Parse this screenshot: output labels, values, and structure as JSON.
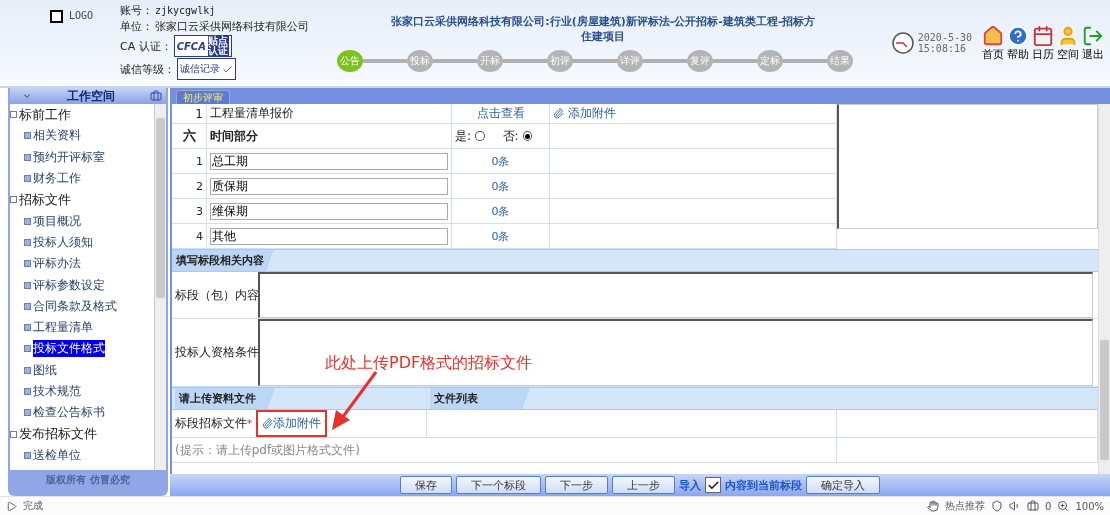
{
  "header": {
    "logo": "LOGO",
    "account_label": "账号：",
    "account": "zjkycgwlkj",
    "unit_label": "单位：",
    "unit": "张家口云采供网络科技有限公司",
    "ca_label": "CA 认证：",
    "ca_badge": "CFCA",
    "ca_badge_note": "贴点认证",
    "credit_label": "诚信等级：",
    "credit_badge": "诚信记录"
  },
  "title": {
    "line1": "张家口云采供网络科技有限公司:行业(房屋建筑)新评标法-公开招标-建筑类工程-招标方",
    "line2": "住建项目"
  },
  "steps": [
    {
      "label": "公告",
      "selected": true
    },
    {
      "label": "投标",
      "selected": false
    },
    {
      "label": "开标",
      "selected": false
    },
    {
      "label": "初评",
      "selected": false
    },
    {
      "label": "详评",
      "selected": false
    },
    {
      "label": "复评",
      "selected": false
    },
    {
      "label": "定标",
      "selected": false
    },
    {
      "label": "结果",
      "selected": false
    }
  ],
  "clock": {
    "date": "2020-5-30",
    "time": "15:08:16"
  },
  "nav": [
    {
      "kind": "home",
      "label": "首页"
    },
    {
      "kind": "help",
      "label": "帮助"
    },
    {
      "kind": "calendar",
      "label": "日历"
    },
    {
      "kind": "space",
      "label": "空间"
    },
    {
      "kind": "exit",
      "label": "退出"
    }
  ],
  "sidebar": {
    "title": "工作空间",
    "footer": "版权所有 仿冒必究",
    "tree": [
      {
        "label": "标前工作",
        "expanded": true,
        "children": [
          {
            "label": "相关资料",
            "selected": false
          },
          {
            "label": "预约开评标室",
            "selected": false
          },
          {
            "label": "财务工作",
            "selected": false
          }
        ]
      },
      {
        "label": "招标文件",
        "expanded": true,
        "children": [
          {
            "label": "项目概况",
            "selected": false
          },
          {
            "label": "投标人须知",
            "selected": false
          },
          {
            "label": "评标办法",
            "selected": false
          },
          {
            "label": "评标参数设定",
            "selected": false
          },
          {
            "label": "合同条款及格式",
            "selected": false
          },
          {
            "label": "工程量清单",
            "selected": false
          },
          {
            "label": "投标文件格式",
            "selected": true
          },
          {
            "label": "图纸",
            "selected": false
          },
          {
            "label": "技术规范",
            "selected": false
          },
          {
            "label": "检查公告标书",
            "selected": false
          }
        ]
      },
      {
        "label": "发布招标文件",
        "expanded": true,
        "children": [
          {
            "label": "送检单位",
            "selected": false
          }
        ]
      }
    ]
  },
  "tabs": [
    {
      "label": "初步评审",
      "selected": true
    }
  ],
  "table": {
    "rows": [
      {
        "kind": "item",
        "num": "1",
        "name": "工程量清单报价",
        "count": "点击查看",
        "attach": "添加附件"
      },
      {
        "kind": "section",
        "num": "六",
        "name": "时间部分",
        "options": [
          {
            "label": "是:",
            "selected": false
          },
          {
            "label": "否:",
            "selected": true
          }
        ]
      },
      {
        "kind": "input",
        "num": "1",
        "value": "总工期",
        "count": "0条"
      },
      {
        "kind": "input",
        "num": "2",
        "value": "质保期",
        "count": "0条"
      },
      {
        "kind": "input",
        "num": "3",
        "value": "维保期",
        "count": "0条"
      },
      {
        "kind": "input",
        "num": "4",
        "value": "其他",
        "count": "0条"
      }
    ]
  },
  "bid_section": {
    "title": "填写标段相关内容",
    "fields": [
      {
        "label": "标段（包）内容"
      },
      {
        "label": "投标人资格条件"
      }
    ]
  },
  "upload": {
    "title": "请上传资料文件",
    "list_title": "文件列表",
    "field_label": "标段招标文件",
    "required_mark": "*",
    "add_link": "添加附件",
    "hint": "(提示：请上传pdf或图片格式文件)"
  },
  "annotation": "此处上传PDF格式的招标文件",
  "toolbar": {
    "buttons": [
      "保存",
      "下一个标段",
      "下一步",
      "上一步"
    ],
    "import_label": "导入",
    "import_checked": true,
    "import_target": "内容到当前标段",
    "confirm": "确定导入"
  },
  "status_bar": {
    "text": "完成",
    "hot": "热点推荐",
    "count": "0",
    "zoom": "100%"
  }
}
